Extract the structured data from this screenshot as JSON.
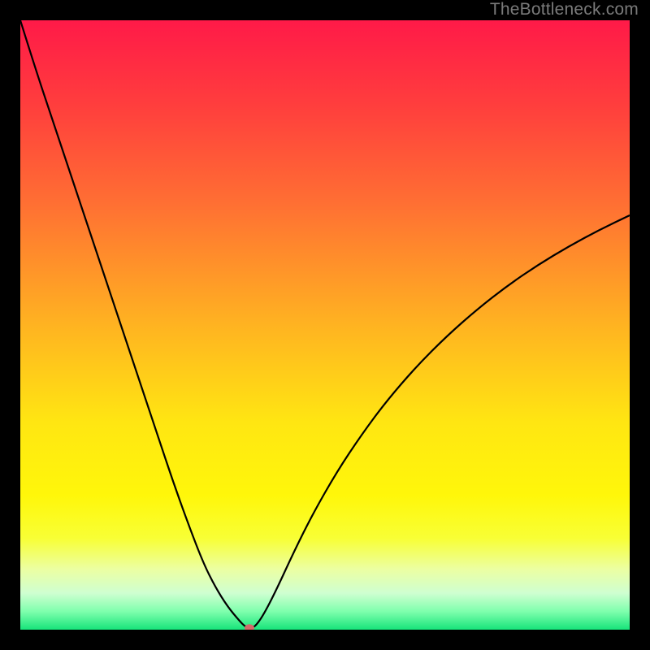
{
  "watermark": {
    "text": "TheBottleneck.com"
  },
  "chart_data": {
    "type": "line",
    "title": "",
    "xlabel": "",
    "ylabel": "",
    "xlim": [
      0,
      100
    ],
    "ylim": [
      0,
      100
    ],
    "grid": false,
    "legend": false,
    "background_gradient_stops": [
      {
        "offset": 0.0,
        "color": "#ff1a48"
      },
      {
        "offset": 0.14,
        "color": "#ff3e3d"
      },
      {
        "offset": 0.3,
        "color": "#ff6f33"
      },
      {
        "offset": 0.5,
        "color": "#ffb321"
      },
      {
        "offset": 0.66,
        "color": "#ffe612"
      },
      {
        "offset": 0.78,
        "color": "#fff70a"
      },
      {
        "offset": 0.85,
        "color": "#f8ff35"
      },
      {
        "offset": 0.9,
        "color": "#ecffa1"
      },
      {
        "offset": 0.94,
        "color": "#cfffd1"
      },
      {
        "offset": 0.97,
        "color": "#7fffad"
      },
      {
        "offset": 1.0,
        "color": "#17e47a"
      }
    ],
    "series": [
      {
        "name": "bottleneck-curve",
        "color": "#000000",
        "stroke_width": 2.2,
        "x": [
          0.0,
          2.5,
          5.0,
          7.5,
          10.0,
          12.5,
          15.0,
          17.5,
          20.0,
          22.5,
          25.0,
          27.5,
          30.0,
          32.0,
          34.0,
          36.0,
          36.8,
          37.4,
          38.0,
          38.7,
          40.0,
          42.0,
          45.0,
          48.0,
          52.0,
          56.0,
          60.0,
          65.0,
          70.0,
          75.0,
          80.0,
          85.0,
          90.0,
          95.0,
          100.0
        ],
        "y": [
          100.0,
          92.0,
          84.5,
          77.0,
          69.5,
          62.0,
          54.5,
          47.0,
          39.5,
          32.0,
          24.5,
          17.5,
          11.0,
          7.0,
          3.8,
          1.4,
          0.6,
          0.3,
          0.3,
          0.7,
          2.6,
          6.5,
          13.0,
          19.0,
          26.0,
          32.0,
          37.4,
          43.2,
          48.2,
          52.6,
          56.5,
          59.9,
          62.9,
          65.6,
          68.0
        ]
      }
    ],
    "marker": {
      "name": "optimal-point",
      "x": 37.6,
      "y": 0.3,
      "color": "#d46a6a",
      "rx": 6,
      "ry": 4.5
    }
  }
}
